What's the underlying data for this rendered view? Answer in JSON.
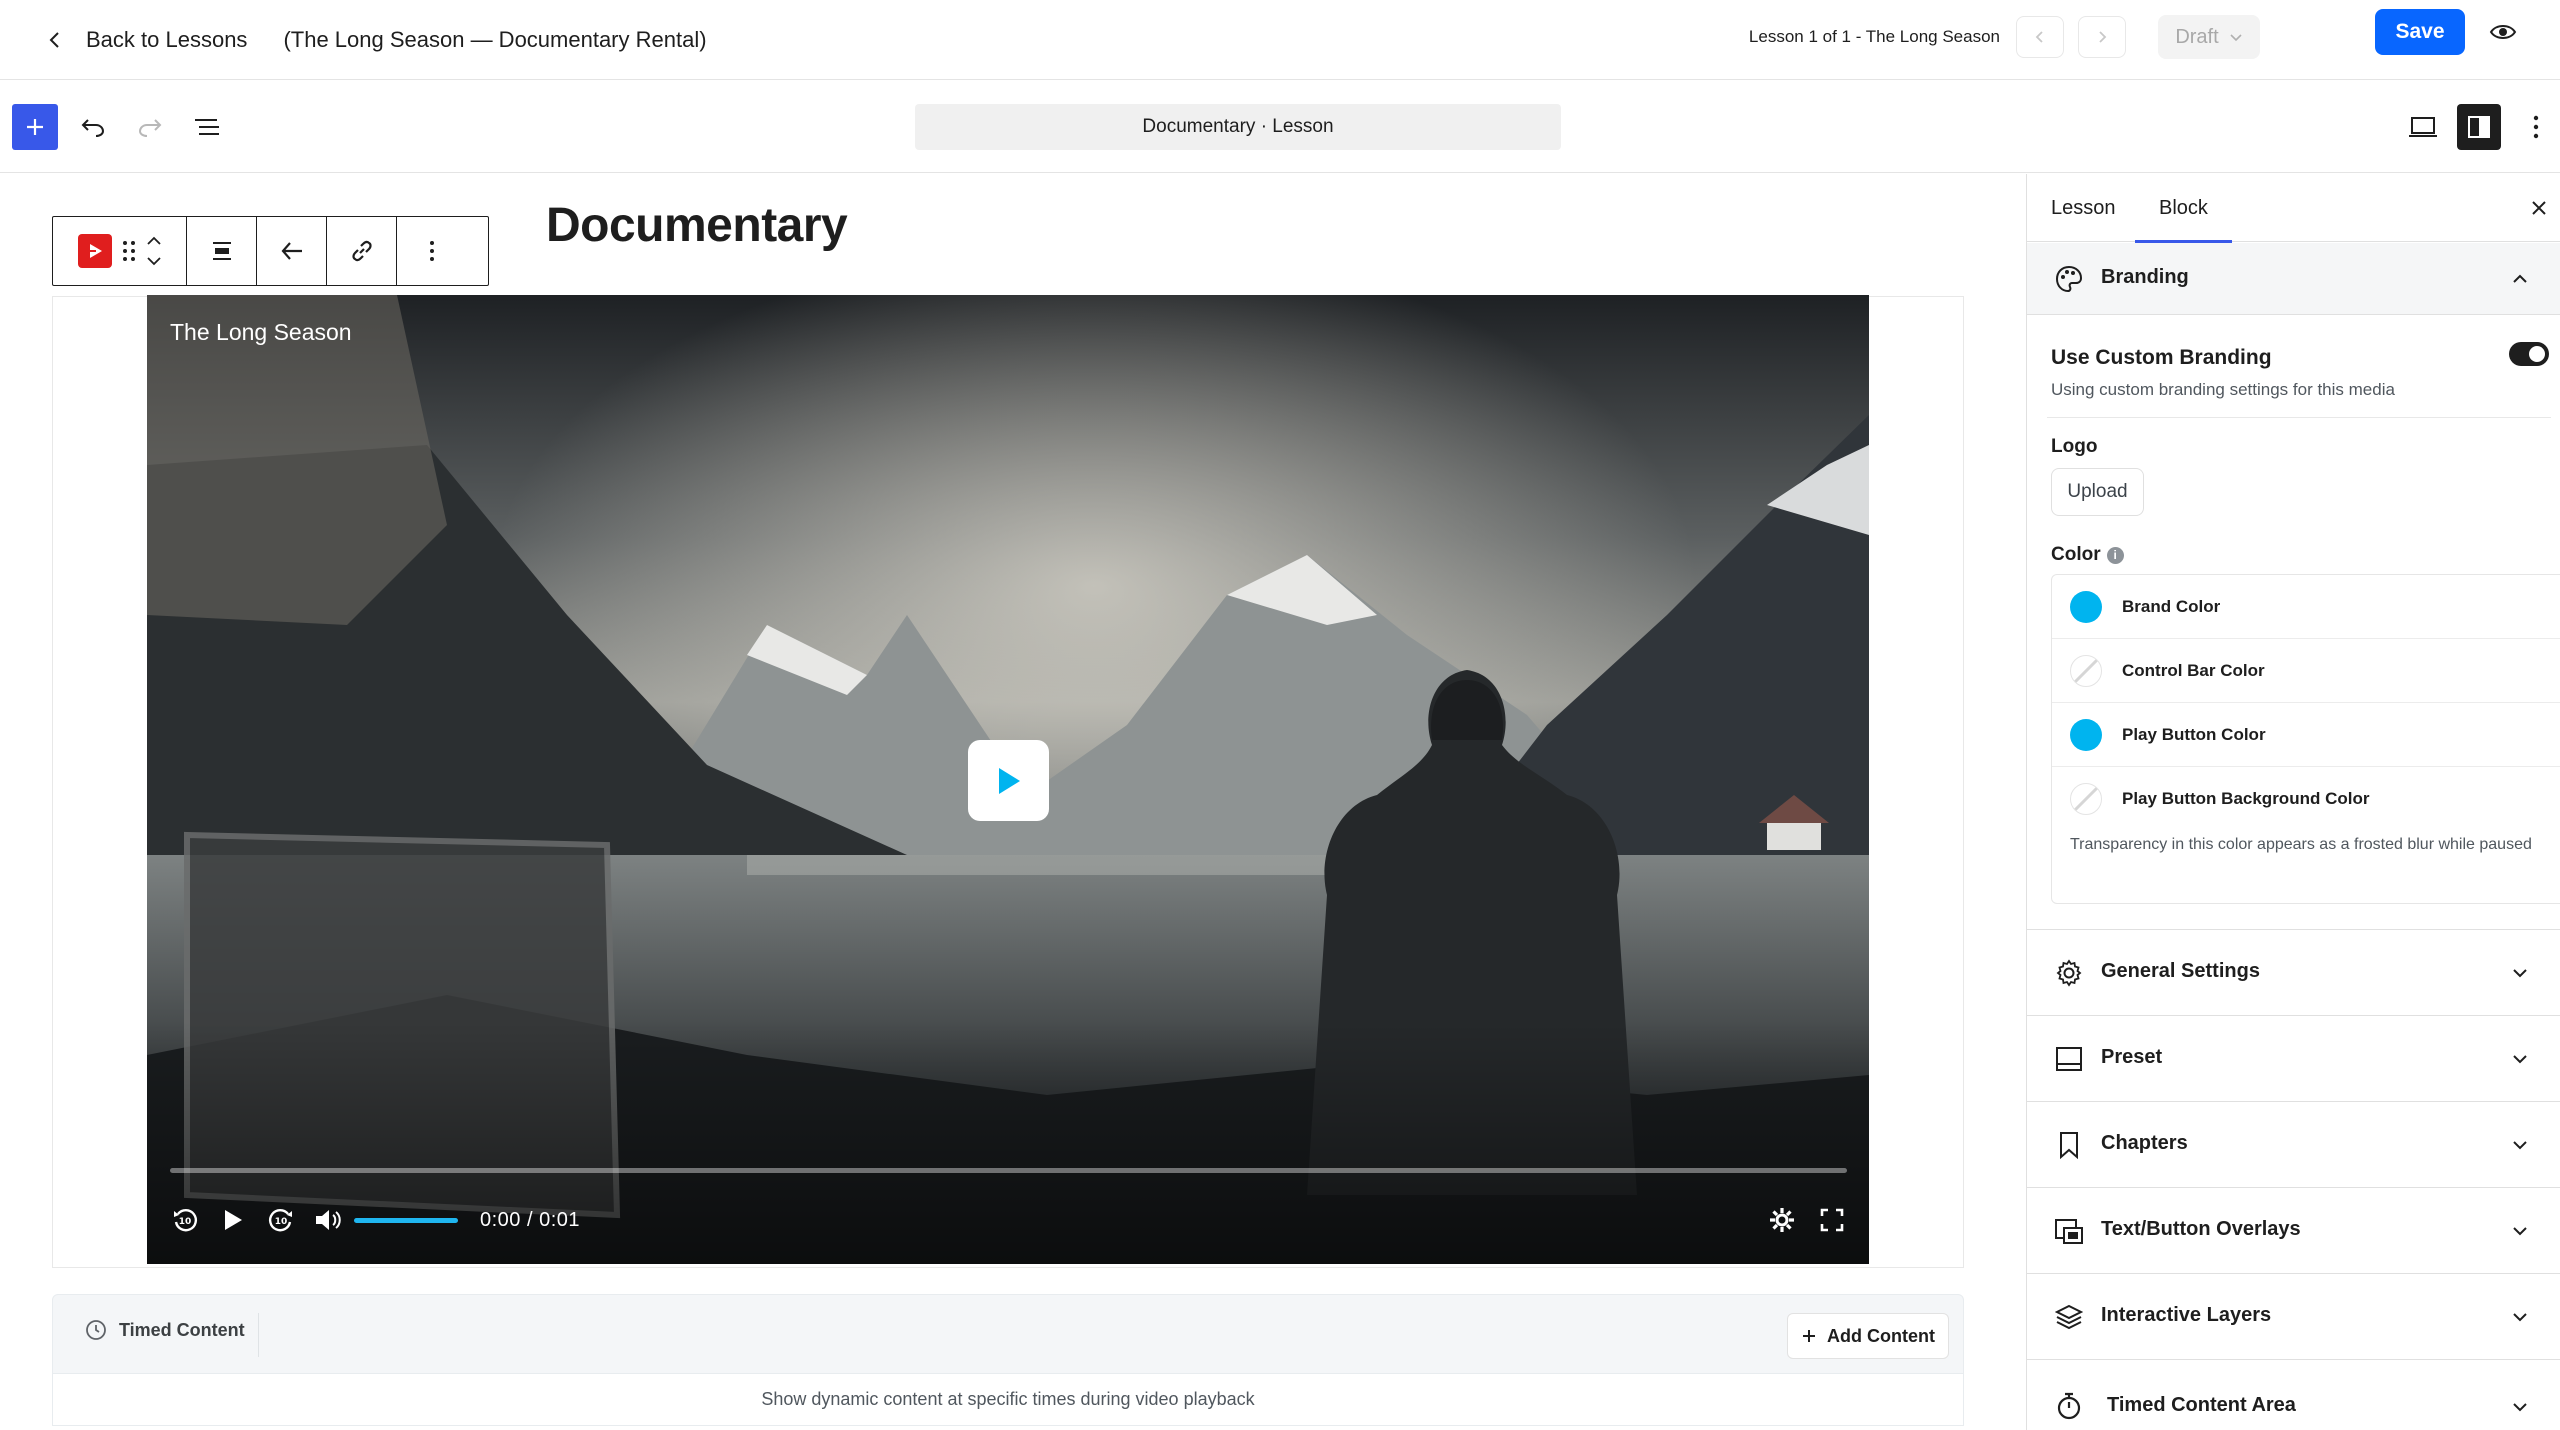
{
  "topbar": {
    "back_label": "Back to Lessons",
    "page_subtitle": "(The Long Season — Documentary Rental)",
    "lesson_crumb": "Lesson 1 of 1 - The Long Season",
    "status_label": "Draft",
    "save_label": "Save"
  },
  "toolbar": {
    "document_pill": "Documentary · Lesson"
  },
  "editor": {
    "title": "Documentary",
    "video": {
      "title": "The Long Season",
      "time_display": "0:00 / 0:01",
      "progress": 0,
      "volume": 1.0
    },
    "timed_content": {
      "label": "Timed Content",
      "add_label": "Add Content",
      "description": "Show dynamic content at specific times during video playback"
    }
  },
  "sidebar": {
    "tabs": [
      {
        "label": "Lesson",
        "active": false
      },
      {
        "label": "Block",
        "active": true
      }
    ],
    "branding": {
      "label": "Branding",
      "expanded": true,
      "use_custom_title": "Use Custom Branding",
      "use_custom_subtitle": "Using custom branding settings for this media",
      "use_custom_enabled": true,
      "logo_label": "Logo",
      "upload_label": "Upload",
      "color_label": "Color",
      "colors": [
        {
          "name": "Brand Color",
          "value": "#00b4ef"
        },
        {
          "name": "Control Bar Color",
          "value": "transparent"
        },
        {
          "name": "Play Button Color",
          "value": "#00b4ef"
        },
        {
          "name": "Play Button Background Color",
          "value": "transparent"
        }
      ],
      "color_help": "Transparency in this color appears as a frosted blur while paused"
    },
    "sections": [
      {
        "label": "General Settings",
        "icon": "gear-icon"
      },
      {
        "label": "Preset",
        "icon": "preset-icon"
      },
      {
        "label": "Chapters",
        "icon": "bookmark-icon"
      },
      {
        "label": "Text/Button Overlays",
        "icon": "overlay-icon"
      },
      {
        "label": "Interactive Layers",
        "icon": "layers-icon"
      },
      {
        "label": "Timed Content Area",
        "icon": "stopwatch-icon"
      }
    ]
  },
  "colors": {
    "accent": "#0866ff",
    "wp_blue": "#3858e9",
    "brand_cyan": "#00b4ef"
  }
}
